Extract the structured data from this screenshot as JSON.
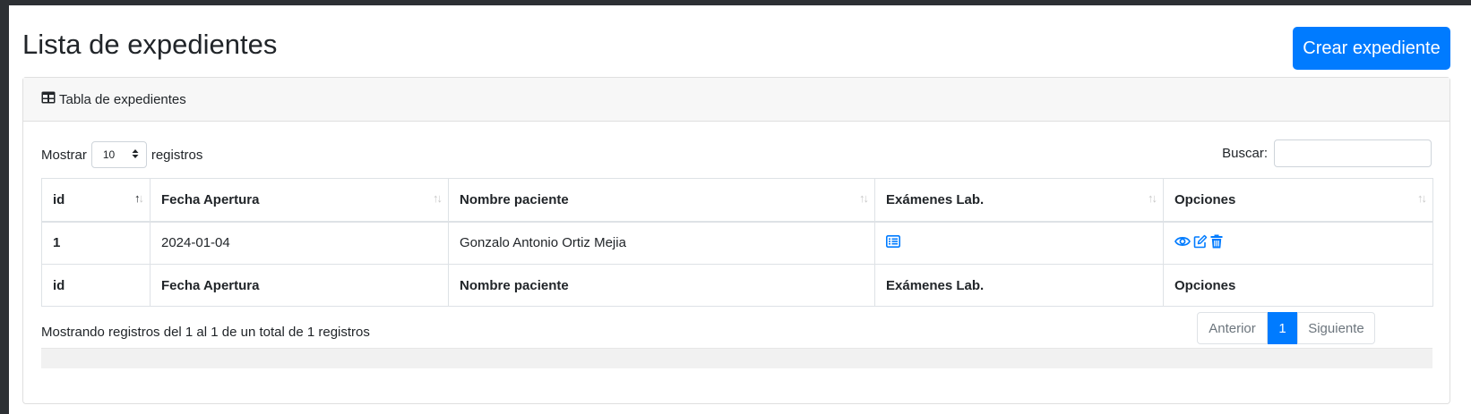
{
  "page": {
    "title": "Lista de expedientes",
    "create_button": "Crear expediente"
  },
  "card": {
    "header_title": "Tabla de expedientes",
    "header_icon": "table-icon"
  },
  "controls": {
    "show_label": "Mostrar",
    "page_length": "10",
    "records_label": "registros",
    "search_label": "Buscar:",
    "search_value": ""
  },
  "table": {
    "columns": [
      "id",
      "Fecha Apertura",
      "Nombre paciente",
      "Exámenes Lab.",
      "Opciones"
    ],
    "rows": [
      {
        "id": "1",
        "fecha": "2024-01-04",
        "nombre": "Gonzalo Antonio Ortiz Mejia",
        "examenes_icon": "list-icon",
        "options_icons": [
          "eye-icon",
          "edit-icon",
          "trash-icon"
        ]
      }
    ],
    "footer": [
      "id",
      "Fecha Apertura",
      "Nombre paciente",
      "Exámenes Lab.",
      "Opciones"
    ]
  },
  "info": "Mostrando registros del 1 al 1 de un total de 1 registros",
  "pagination": {
    "previous": "Anterior",
    "current": "1",
    "next": "Siguiente"
  },
  "colors": {
    "primary": "#007bff",
    "page_bg": "#ffffff",
    "frame_bg": "#2d3034"
  }
}
